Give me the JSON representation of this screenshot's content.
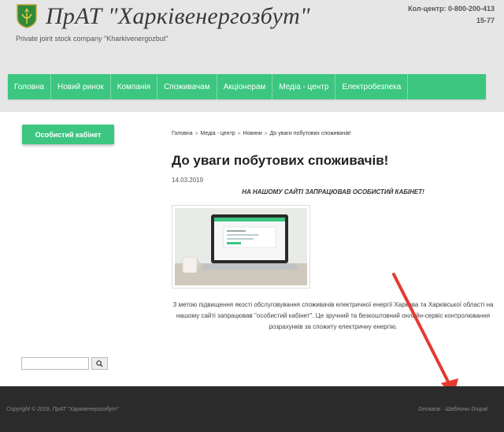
{
  "header": {
    "title": "ПрАТ \"Харківенергозбут\"",
    "slogan": "Private joint stock company \"Kharkivenergozbut\"",
    "contact_line": "Кол-центр: 0-800-200-413",
    "contact_ext": "15-77"
  },
  "nav": {
    "items": [
      {
        "label": "Головна"
      },
      {
        "label": "Новий ринок"
      },
      {
        "label": "Компанія"
      },
      {
        "label": "Споживачам"
      },
      {
        "label": "Акціонерам"
      },
      {
        "label": "Медіа - центр"
      },
      {
        "label": "Електробезпека"
      }
    ]
  },
  "sidebar": {
    "cabinet_label": "Особистий кабінет",
    "search_value": ""
  },
  "breadcrumb": {
    "items": [
      "Головна",
      "Медіа - центр",
      "Новини",
      "До уваги побутових споживачів!"
    ],
    "separator": "»"
  },
  "article": {
    "title": "До уваги побутових споживачів!",
    "date": "14.03.2019",
    "lead": "НА НАШОМУ САЙТІ ЗАПРАЦЮВАВ ОСОБИСТИЙ КАБІНЕТ!",
    "body": "З метою підвищення якості обслуговування споживачів електричної енергії Харкова та Харківської області на нашому сайті запрацював \"особистий кабінет\". Це зручний та безкоштовний онлайн-сервіс контролювання розрахунків за спожиту електричну енергію."
  },
  "footer": {
    "copyright": "Copyright © 2019, ПрАТ \"Харківенергозбут\"",
    "developer": "Devaarai · Шаблоны Drupal"
  },
  "colors": {
    "accent": "#3cc680",
    "footer_bg": "#2b2b2b",
    "annotation_arrow": "#e53a2f"
  }
}
